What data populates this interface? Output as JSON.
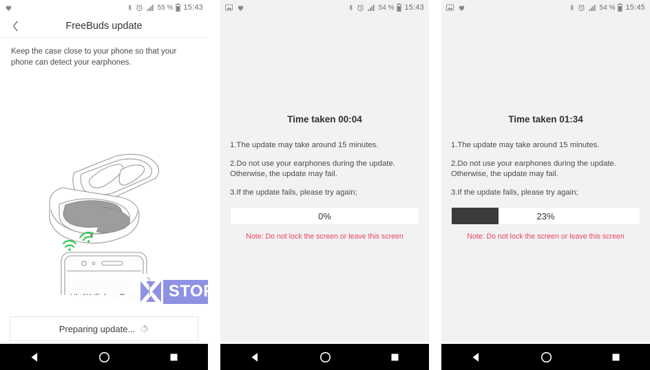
{
  "panels": [
    {
      "id": "panel-prepare",
      "status": {
        "left_icons": [
          "heart-notification-icon"
        ],
        "right_icons": [
          "bluetooth-icon",
          "alarm-icon",
          "signal-icon"
        ],
        "battery": "55 %",
        "time": "15:43"
      },
      "header": {
        "back_icon": "chevron-left-icon",
        "title": "FreeBuds update"
      },
      "description": "Keep the case close to your phone so that your phone can detect your earphones.",
      "illustration": {
        "case_label": "earbuds-case-open",
        "phone_label": "HUAWEI FreeBuds",
        "wave_icons": [
          "signal-wave-icon",
          "signal-wave-icon"
        ],
        "wave_color": "#2fc84f"
      },
      "button": {
        "label": "Preparing update...",
        "icon": "spinner-icon"
      }
    },
    {
      "id": "panel-progress-0",
      "status": {
        "left_icons": [
          "image-icon",
          "heart-notification-icon"
        ],
        "right_icons": [
          "bluetooth-icon",
          "alarm-icon",
          "signal-icon"
        ],
        "battery": "54 %",
        "time": "15:43"
      },
      "heading": "Time taken 00:04",
      "steps": [
        "1.The update may take around 15 minutes.",
        "2.Do not use your earphones during the update. Otherwise, the update may fail.",
        "3.If the update fails, please try again;"
      ],
      "progress": {
        "percent_label": "0%",
        "percent_value": 0,
        "fill_color": "#3b3b3b"
      },
      "note": "Note: Do not lock the screen or leave this screen",
      "note_color": "#e8455f"
    },
    {
      "id": "panel-progress-23",
      "status": {
        "left_icons": [
          "image-icon",
          "heart-notification-icon"
        ],
        "right_icons": [
          "bluetooth-icon",
          "alarm-icon",
          "signal-icon"
        ],
        "battery": "54 %",
        "time": "15:45"
      },
      "heading": "Time taken 01:34",
      "steps": [
        "1.The update may take around 15 minutes.",
        "2.Do not use your earphones during the update. Otherwise, the update may fail.",
        "3.If the update fails, please try again;"
      ],
      "progress": {
        "percent_label": "23%",
        "percent_value": 25,
        "fill_color": "#3b3b3b"
      },
      "note": "Note: Do not lock the screen or leave this screen",
      "note_color": "#e8455f"
    }
  ],
  "navbar": {
    "back_icon": "nav-back-triangle-icon",
    "home_icon": "nav-home-circle-icon",
    "recents_icon": "nav-recents-square-icon"
  },
  "watermark": {
    "text_left": "PIXEL",
    "text_right": "STORY",
    "accent": "#8e92e4"
  }
}
